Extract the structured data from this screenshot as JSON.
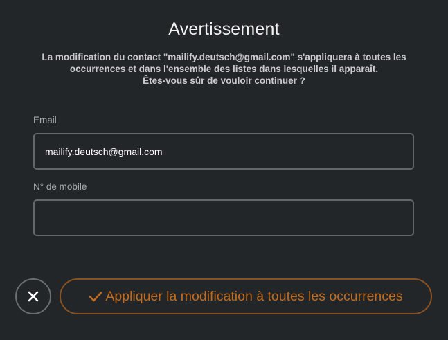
{
  "dialog": {
    "title": "Avertissement",
    "message_lines": [
      "La modification du contact \"mailify.deutsch@gmail.com\" s'appliquera à toutes les",
      "occurrences et dans l'ensemble des listes dans lesquelles il apparaît.",
      "Êtes-vous sûr de vouloir continuer ?"
    ]
  },
  "form": {
    "email_label": "Email",
    "email_value": "mailify.deutsch@gmail.com",
    "mobile_label": "N° de mobile",
    "mobile_value": ""
  },
  "actions": {
    "close_icon": "close-icon",
    "apply_icon": "check-icon",
    "apply_label": "Appliquer la modification à toutes les occurrences"
  },
  "colors": {
    "background": "#222629",
    "accent": "#c46c1e",
    "accent_border": "#8a5220",
    "input_border": "#62676b"
  }
}
